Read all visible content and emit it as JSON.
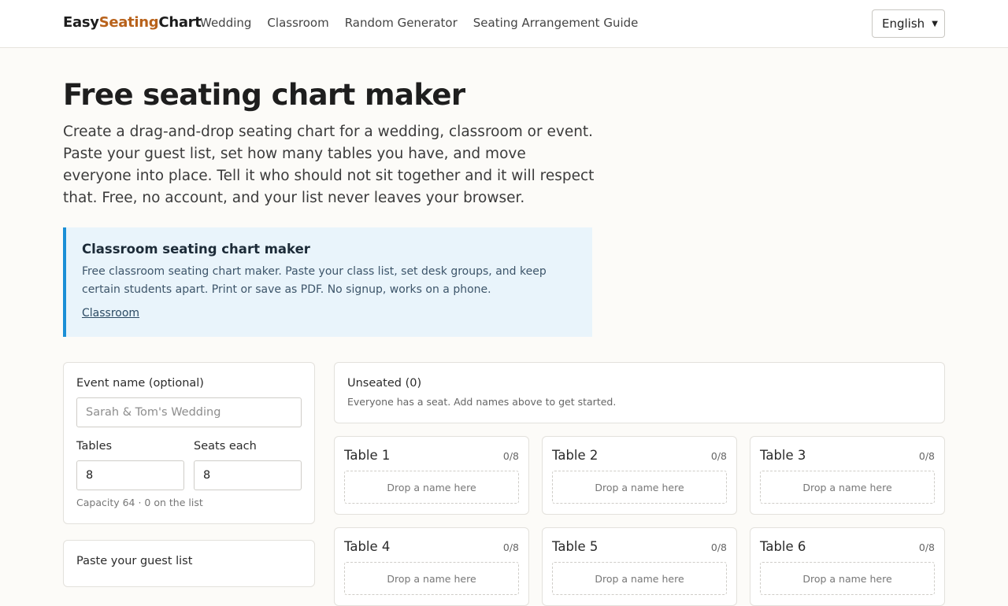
{
  "brand": {
    "part1": "Easy",
    "part2": "Seating",
    "part3": "Chart"
  },
  "nav": [
    "Wedding",
    "Classroom",
    "Random Generator",
    "Seating Arrangement Guide"
  ],
  "language": {
    "selected": "English"
  },
  "hero": {
    "title": "Free seating chart maker",
    "description": "Create a drag-and-drop seating chart for a wedding, classroom or event. Paste your guest list, set how many tables you have, and move everyone into place. Tell it who should not sit together and it will respect that. Free, no account, and your list never leaves your browser."
  },
  "callout": {
    "title": "Classroom seating chart maker",
    "text": "Free classroom seating chart maker. Paste your class list, set desk groups, and keep certain students apart. Print or save as PDF. No signup, works on a phone.",
    "link": "Classroom"
  },
  "settings": {
    "event_label": "Event name (optional)",
    "event_placeholder": "Sarah & Tom's Wedding",
    "tables_label": "Tables",
    "tables_value": "8",
    "seats_label": "Seats each",
    "seats_value": "8",
    "capacity_text": "Capacity 64 · 0 on the list"
  },
  "paste": {
    "label": "Paste your guest list"
  },
  "unseated": {
    "title": "Unseated (0)",
    "message": "Everyone has a seat. Add names above to get started."
  },
  "drop_placeholder": "Drop a name here",
  "tables": [
    {
      "name": "Table 1",
      "count": "0/8"
    },
    {
      "name": "Table 2",
      "count": "0/8"
    },
    {
      "name": "Table 3",
      "count": "0/8"
    },
    {
      "name": "Table 4",
      "count": "0/8"
    },
    {
      "name": "Table 5",
      "count": "0/8"
    },
    {
      "name": "Table 6",
      "count": "0/8"
    }
  ],
  "colors": {
    "accent": "#b8621b",
    "callout_border": "#1b8fd6",
    "callout_bg": "#e9f4fb"
  },
  "icons": {
    "language_dropdown": "chevron-down-icon"
  }
}
